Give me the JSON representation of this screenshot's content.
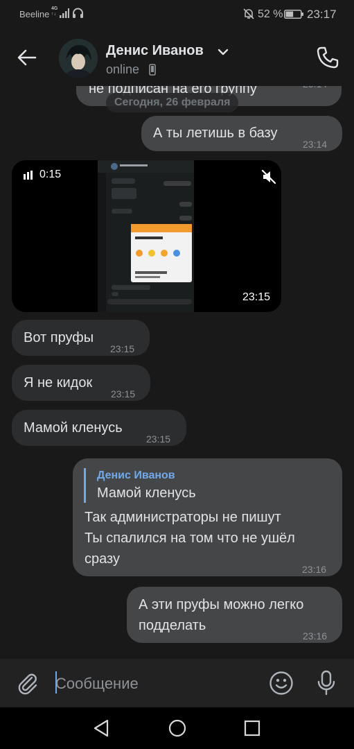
{
  "status_bar": {
    "carrier": "Beeline",
    "network": "4G",
    "network_sub": "↑↓",
    "battery_percent": "52 %",
    "battery_level": 0.52,
    "clock": "23:17"
  },
  "header": {
    "contact_name": "Денис Иванов",
    "presence": "online"
  },
  "date_divider": "Сегодня, 26 февраля",
  "messages": [
    {
      "text": "не подписан на его группу",
      "time": "23:14",
      "direction": "out"
    },
    {
      "text": "А ты летишь в базу",
      "time": "23:14",
      "direction": "out"
    },
    {
      "video_duration": "0:15",
      "time": "23:15",
      "direction": "in"
    },
    {
      "text": "Вот пруфы",
      "time": "23:15",
      "direction": "in"
    },
    {
      "text": "Я не кидок",
      "time": "23:15",
      "direction": "in"
    },
    {
      "text": "Мамой кленусь",
      "time": "23:15",
      "direction": "in"
    },
    {
      "quote_author": "Денис Иванов",
      "quote_text": "Мамой кленусь",
      "text_lines": [
        "Так администраторы не пишут",
        "Ты спалился на том что не ушёл",
        "сразу"
      ],
      "time": "23:16",
      "direction": "out"
    },
    {
      "text_lines": [
        "А эти пруфы можно легко",
        "подделать"
      ],
      "time": "23:16",
      "direction": "out"
    }
  ],
  "composer": {
    "placeholder": "Сообщение"
  },
  "colors": {
    "background": "#19191a",
    "bubble_out": "#454647",
    "bubble_in": "#2c2d2e",
    "accent": "#71aaeb"
  },
  "icons": [
    "back-arrow-icon",
    "chevron-down-icon",
    "mobile-icon",
    "phone-icon",
    "paperclip-icon",
    "emoji-icon",
    "microphone-icon",
    "muted-speaker-icon"
  ]
}
